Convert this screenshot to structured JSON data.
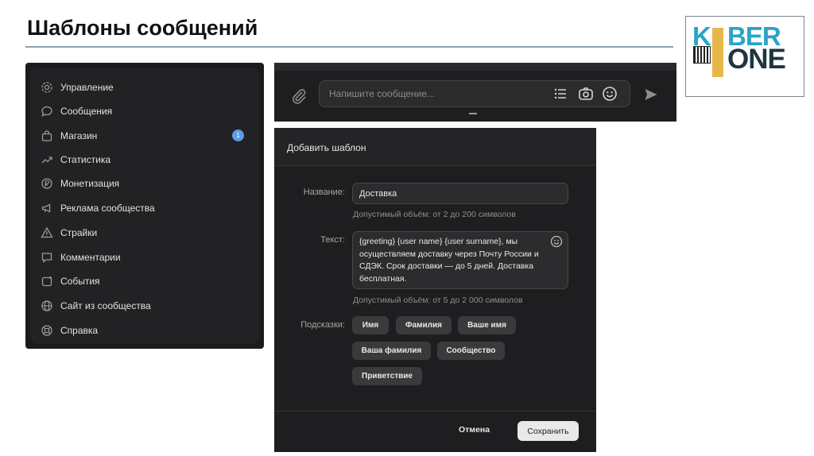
{
  "slide": {
    "title": "Шаблоны сообщений"
  },
  "logo": {
    "line1_left": "K",
    "line1_right": "BER",
    "line2": "ONE"
  },
  "nav": {
    "items": [
      {
        "label": "Управление",
        "icon": "gear-icon"
      },
      {
        "label": "Сообщения",
        "icon": "chat-bubble-icon"
      },
      {
        "label": "Магазин",
        "icon": "shopping-bag-icon",
        "badge": "1"
      },
      {
        "label": "Статистика",
        "icon": "trend-up-icon"
      },
      {
        "label": "Монетизация",
        "icon": "ruble-coin-icon"
      },
      {
        "label": "Реклама сообщества",
        "icon": "megaphone-icon"
      },
      {
        "label": "Страйки",
        "icon": "warning-triangle-icon"
      },
      {
        "label": "Комментарии",
        "icon": "comment-icon"
      },
      {
        "label": "События",
        "icon": "calendar-icon"
      },
      {
        "label": "Сайт из сообщества",
        "icon": "globe-icon"
      },
      {
        "label": "Справка",
        "icon": "lifebuoy-icon"
      }
    ],
    "badge_color": "#5c9ce6"
  },
  "composer": {
    "placeholder": "Напишите сообщение..."
  },
  "dialog": {
    "title": "Добавить шаблон",
    "name_label": "Название:",
    "name_value": "Доставка",
    "name_hint": "Допустимый объём: от 2 до 200 символов",
    "text_label": "Текст:",
    "text_value": "{greeting} {user name} {user surname}, мы осуществляем доставку через Почту России и СДЭК. Срок доставки — до 5 дней. Доставка бесплатная.",
    "text_hint": "Допустимый объём: от 5 до 2 000 символов",
    "hints_label": "Подсказки:",
    "chips": [
      "Имя",
      "Фамилия",
      "Ваше имя",
      "Ваша фамилия",
      "Сообщество",
      "Приветствие"
    ],
    "cancel_label": "Отмена",
    "save_label": "Сохранить"
  }
}
